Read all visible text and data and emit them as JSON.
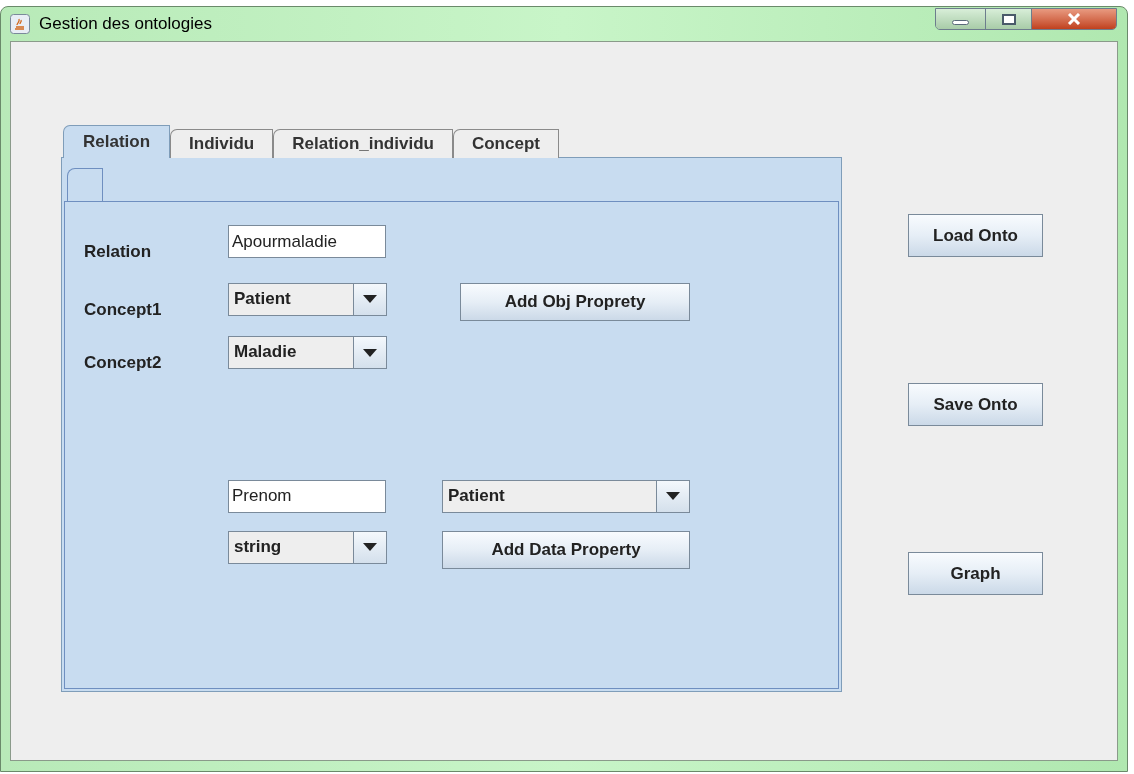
{
  "window": {
    "title": "Gestion des ontologies"
  },
  "tabs": [
    {
      "label": "Relation",
      "selected": true
    },
    {
      "label": "Individu",
      "selected": false
    },
    {
      "label": "Relation_individu",
      "selected": false
    },
    {
      "label": "Concept",
      "selected": false
    }
  ],
  "object_property": {
    "relation_label": "Relation",
    "relation": "Apourmaladie",
    "concept1_label": "Concept1",
    "concept1": "Patient",
    "concept2_label": "Concept2",
    "concept2": "Maladie",
    "button": "Add Obj Proprety"
  },
  "data_property": {
    "name": "Prenom",
    "domain": "Patient",
    "type": "string",
    "button": "Add Data Property"
  },
  "side_buttons": [
    "Load Onto",
    "Save Onto",
    "Graph"
  ]
}
